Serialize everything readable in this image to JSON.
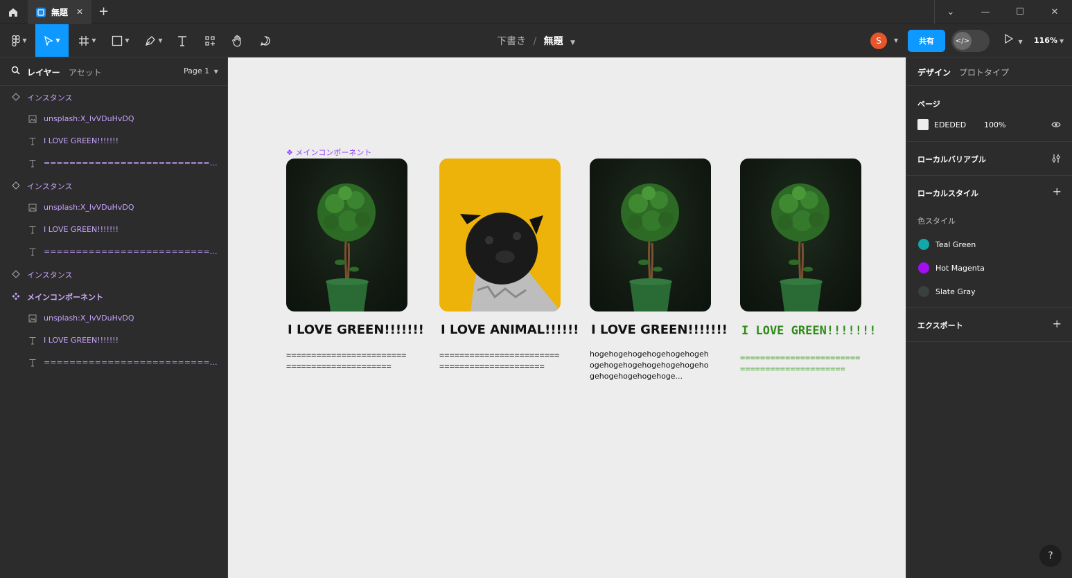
{
  "tabs": {
    "active_label": "無題"
  },
  "toolbar": {
    "breadcrumb_parent": "下書き",
    "breadcrumb_sep": "/",
    "file_name": "無題",
    "avatar_initial": "S",
    "share_label": "共有",
    "zoom": "116%"
  },
  "left_panel": {
    "tab_layers": "レイヤー",
    "tab_assets": "アセット",
    "page_selector": "Page 1",
    "layers": [
      {
        "label": "インスタンス",
        "icon": "instance-icon",
        "indent": 0
      },
      {
        "label": "unsplash:X_IvVDuHvDQ",
        "icon": "image-icon",
        "indent": 1
      },
      {
        "label": "I LOVE GREEN!!!!!!!",
        "icon": "text-icon",
        "indent": 1
      },
      {
        "label": "=======================================",
        "icon": "text-icon",
        "indent": 1
      },
      {
        "label": "インスタンス",
        "icon": "instance-icon",
        "indent": 0
      },
      {
        "label": "unsplash:X_IvVDuHvDQ",
        "icon": "image-icon",
        "indent": 1
      },
      {
        "label": "I LOVE GREEN!!!!!!!",
        "icon": "text-icon",
        "indent": 1
      },
      {
        "label": "=======================================",
        "icon": "text-icon",
        "indent": 1
      },
      {
        "label": "インスタンス",
        "icon": "instance-icon",
        "indent": 0
      },
      {
        "label": "メインコンポーネント",
        "icon": "component-icon",
        "indent": 0
      },
      {
        "label": "unsplash:X_IvVDuHvDQ",
        "icon": "image-icon",
        "indent": 1
      },
      {
        "label": "I LOVE GREEN!!!!!!!",
        "icon": "text-icon",
        "indent": 1
      },
      {
        "label": "=======================================",
        "icon": "text-icon",
        "indent": 1
      }
    ]
  },
  "canvas": {
    "component_label": "❖ メインコンポーネント",
    "cards": [
      {
        "title": "I LOVE GREEN!!!!!!!",
        "body": "=============================================",
        "image": "plant"
      },
      {
        "title": "I LOVE ANIMAL!!!!!!",
        "body": "=============================================",
        "image": "dog"
      },
      {
        "title": "I LOVE GREEN!!!!!!!",
        "body": "hogehogehogehogehogehogehogehogehogehogehogehogehogehogehogehogehoge...",
        "image": "plant"
      },
      {
        "title": "I LOVE GREEN!!!!!!!",
        "body": "=============================================",
        "image": "plant"
      }
    ]
  },
  "right_panel": {
    "tab_design": "デザイン",
    "tab_prototype": "プロトタイプ",
    "page_title": "ページ",
    "page_color_hex": "EDEDED",
    "page_opacity": "100%",
    "local_variables": "ローカルバリアブル",
    "local_styles": "ローカルスタイル",
    "color_styles_label": "色スタイル",
    "color_styles": [
      {
        "name": "Teal Green",
        "color": "#14a7a7"
      },
      {
        "name": "Hot Magenta",
        "color": "#a20ff2"
      },
      {
        "name": "Slate Gray",
        "color": "#3a3f3f"
      }
    ],
    "export": "エクスポート"
  },
  "help": "?"
}
